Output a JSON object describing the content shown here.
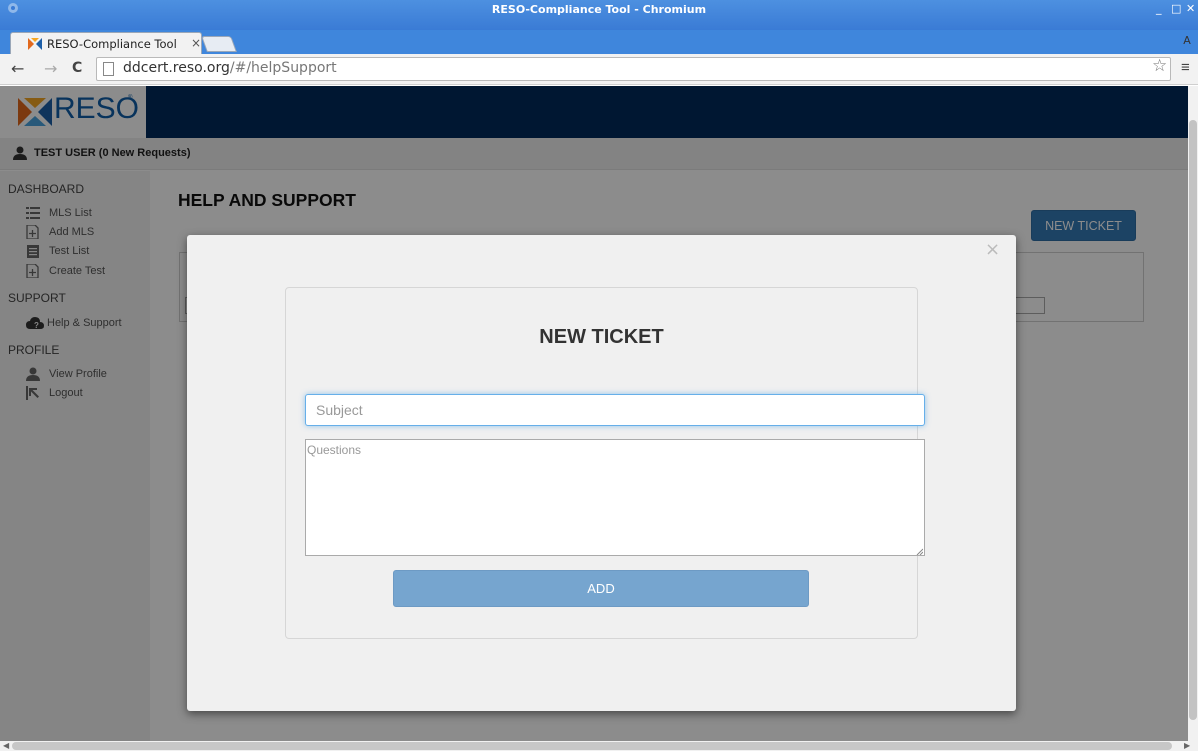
{
  "browser": {
    "window_title": "RESO-Compliance Tool - Chromium",
    "window_controls": {
      "minimize": "_",
      "maximize": "□",
      "close": "✕"
    },
    "tab_title": "RESO-Compliance Tool",
    "tab_close": "×",
    "url_domain": "ddcert.reso.org",
    "url_path": "/#/helpSupport",
    "back": "←",
    "forward": "→",
    "reload": "C",
    "bookmark": "☆",
    "menu": "≡",
    "profile": "A"
  },
  "header": {
    "logo_text": "RESO",
    "brand_color": "#002b5c",
    "logo_color": "#0f5ea8"
  },
  "userbar": {
    "user_label": "TEST USER (0 New Requests)"
  },
  "sidebar": {
    "sections": [
      {
        "title": "DASHBOARD"
      },
      {
        "title": "SUPPORT"
      },
      {
        "title": "PROFILE"
      }
    ],
    "items": [
      {
        "label": "MLS List",
        "icon": "list-icon"
      },
      {
        "label": "Add MLS",
        "icon": "add-file-icon"
      },
      {
        "label": "Test List",
        "icon": "notepad-icon"
      },
      {
        "label": "Create Test",
        "icon": "add-file-icon"
      },
      {
        "label": "Help & Support",
        "icon": "cloud-help-icon"
      },
      {
        "label": "View Profile",
        "icon": "user-icon"
      },
      {
        "label": "Logout",
        "icon": "logout-arrow-icon"
      }
    ]
  },
  "main": {
    "page_title": "HELP AND SUPPORT",
    "new_ticket_button": "NEW TICKET",
    "accent_color": "#337ab7"
  },
  "modal": {
    "close": "×",
    "title": "NEW TICKET",
    "subject_placeholder": "Subject",
    "subject_value": "",
    "questions_placeholder": "Questions",
    "questions_value": "",
    "add_button": "ADD"
  }
}
